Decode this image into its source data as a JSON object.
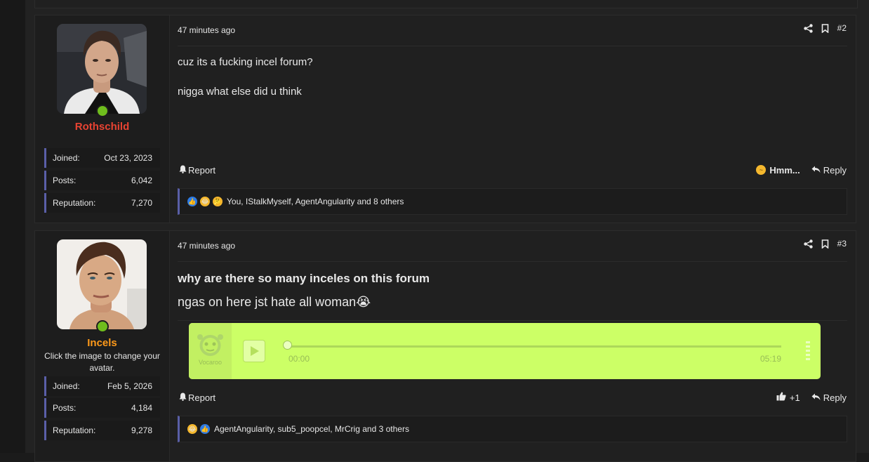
{
  "colors": {
    "accent_border": "#5a5fa8",
    "online": "#6fbd1d",
    "user1_name": "#e84332",
    "user2_name": "#ff9a1a",
    "vocaroo_bg": "#ccff66"
  },
  "post_actions": {
    "share_icon": "share-icon",
    "bookmark_icon": "bookmark-icon",
    "report_label": "Report",
    "reply_label": "Reply"
  },
  "posts": [
    {
      "username": "Rothschild",
      "stats": [
        {
          "label": "Joined:",
          "value": "Oct 23, 2023"
        },
        {
          "label": "Posts:",
          "value": "6,042"
        },
        {
          "label": "Reputation:",
          "value": "7,270"
        }
      ],
      "date": "47 minutes ago",
      "number": "#2",
      "body": [
        "cuz its a fucking incel forum?",
        "nigga what else did u think"
      ],
      "user_reaction_label": "Hmm...",
      "reactions_text": "You, IStalkMyself, AgentAngularity and 8 others"
    },
    {
      "username": "Incels",
      "avatar_hint": "Click the image to change your avatar.",
      "stats": [
        {
          "label": "Joined:",
          "value": "Feb 5, 2026"
        },
        {
          "label": "Posts:",
          "value": "4,184"
        },
        {
          "label": "Reputation:",
          "value": "9,278"
        }
      ],
      "date": "47 minutes ago",
      "number": "#3",
      "title": "why are there so many inceles on this forum",
      "body_line": "ngas on here jst hate all woman😭",
      "vocaroo": {
        "logo_text": "Vocaroo",
        "current_time": "00:00",
        "duration": "05:19",
        "progress": 0
      },
      "like_count": "+1",
      "reactions_text": "AgentAngularity, sub5_poopcel, MrCrig and 3 others"
    }
  ]
}
